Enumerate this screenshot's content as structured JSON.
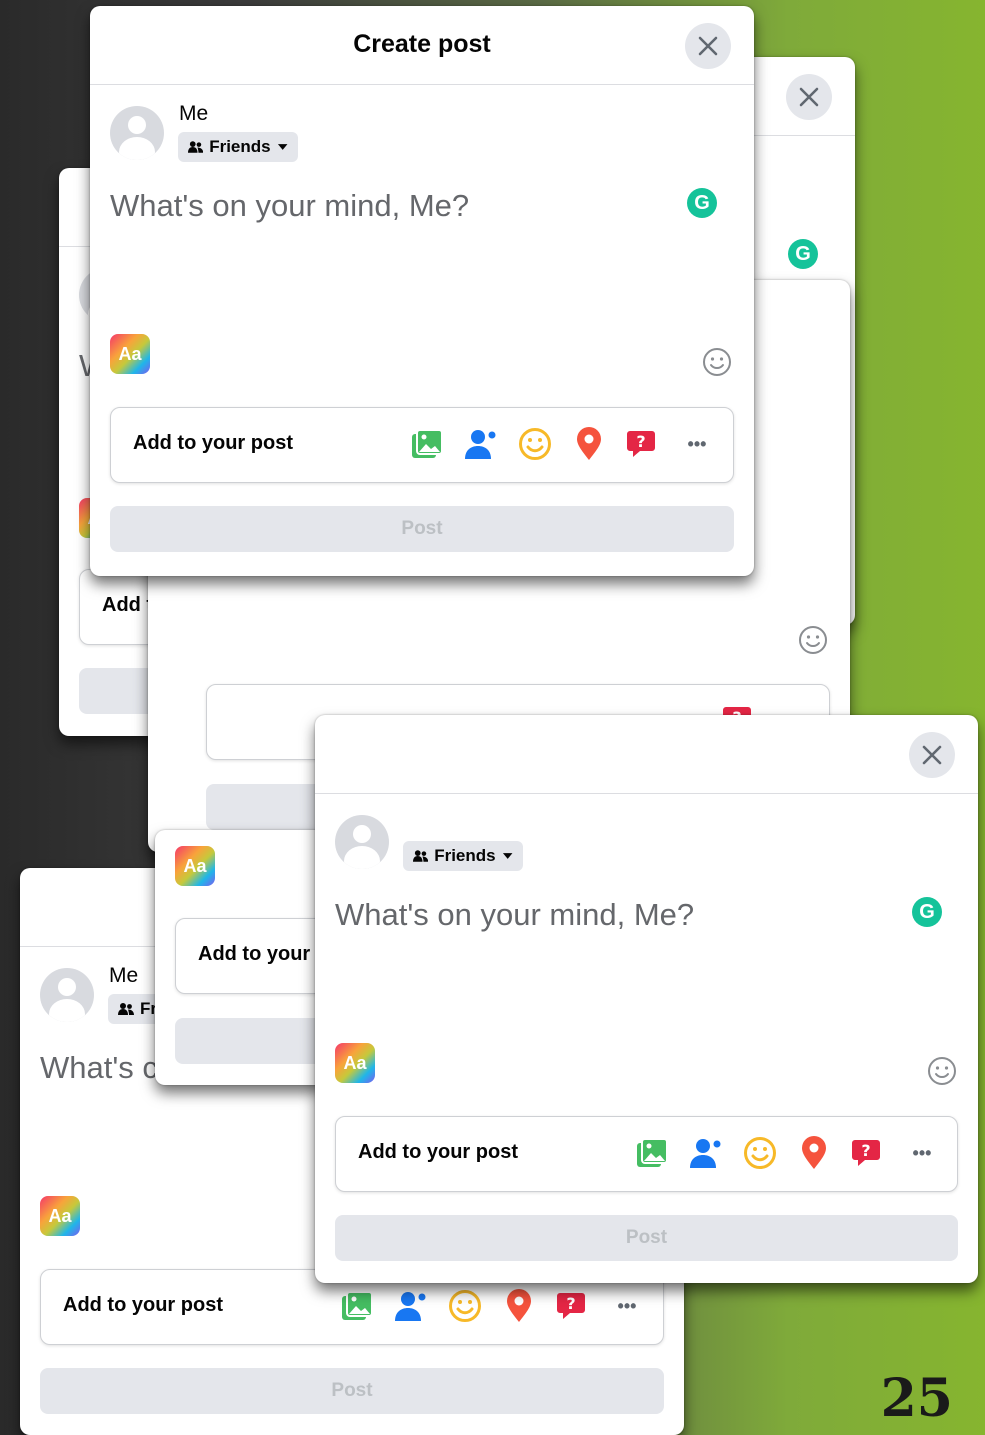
{
  "dialog": {
    "title": "Create post",
    "user_name": "Me",
    "audience": "Friends",
    "composer_placeholder": "What's on your mind, Me?",
    "text_format_label": "Aa",
    "grammarly_label": "G",
    "add_to_post_label": "Add to your post",
    "post_button_label": "Post",
    "more_label": "•••"
  },
  "fragments": {
    "add_to_post_partial": "Add to yo",
    "add_to_post_partial_2": "Add to your",
    "placeholder_partial": "What's c",
    "audience_partial": "Fr",
    "placeholder_partial_2": "W"
  },
  "icons": [
    "photo-video-icon",
    "tag-people-icon",
    "feeling-icon",
    "checkin-icon",
    "qa-icon",
    "more-icon"
  ],
  "colors": {
    "photo": "#45bd62",
    "tag": "#1877f2",
    "feeling": "#f7b928",
    "checkin": "#f5533d",
    "qa": "#e42645",
    "grammarly": "#15c39a"
  },
  "page_number": "25"
}
